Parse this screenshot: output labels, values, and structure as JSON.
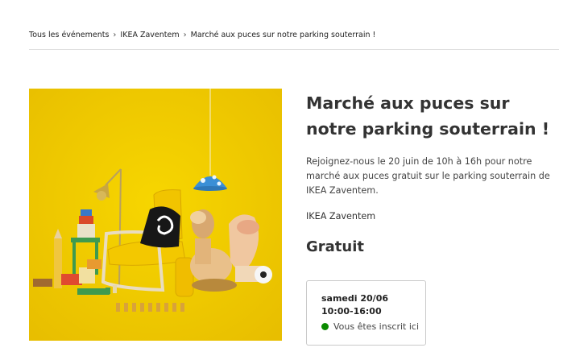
{
  "breadcrumb": {
    "items": [
      {
        "label": "Tous les événements"
      },
      {
        "label": "IKEA Zaventem"
      },
      {
        "label": "Marché aux puces sur notre parking souterrain !"
      }
    ]
  },
  "event": {
    "title": "Marché aux puces sur notre parking souterrain !",
    "description": "Rejoignez-nous le 20 juin de 10h à 16h pour notre marché aux puces gratuit sur le parking souterrain de IKEA Zaventem.",
    "location": "IKEA Zaventem",
    "price": "Gratuit",
    "slot": {
      "date": "samedi 20/06 10:00-16:00",
      "status": "Vous êtes inscrit ici",
      "status_color": "#0a8a00"
    }
  },
  "hero": {
    "background_color": "#f2cd00"
  }
}
